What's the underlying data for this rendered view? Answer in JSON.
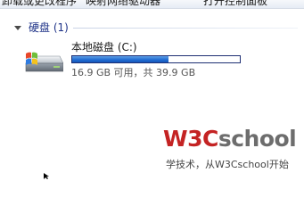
{
  "toolbar": {
    "items": [
      "卸载或更改程序",
      "映射网络驱动器",
      "打开控制面板"
    ]
  },
  "group": {
    "title": "硬盘 (1)"
  },
  "drive": {
    "name": "本地磁盘 (C:)",
    "free_text": "16.9 GB 可用，共 39.9 GB",
    "used_fraction": 0.576,
    "bar_color": "#1f6ad2"
  },
  "watermark": {
    "logo_w3": "W3C",
    "logo_rest": "school",
    "slogan": "学技术，从W3Cschool开始"
  }
}
